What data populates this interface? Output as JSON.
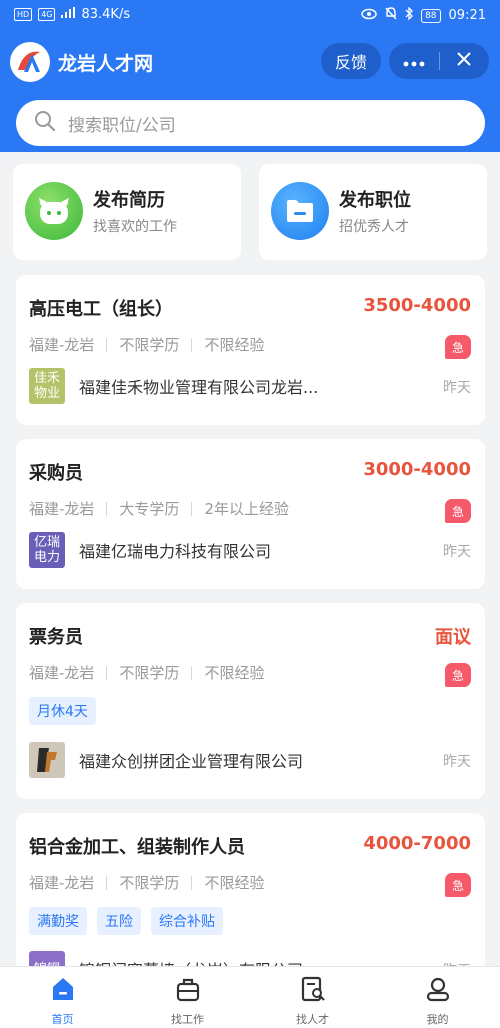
{
  "status_bar": {
    "left_badges": [
      "HD",
      "4G"
    ],
    "speed": "83.4K/s",
    "battery": "88",
    "time": "09:21"
  },
  "app": {
    "title": "龙岩人才网",
    "feedback": "反馈"
  },
  "search": {
    "placeholder": "搜索职位/公司"
  },
  "actions": [
    {
      "title": "发布简历",
      "subtitle": "找喜欢的工作",
      "icon": "face-icon",
      "color": "#5cc84a"
    },
    {
      "title": "发布职位",
      "subtitle": "招优秀人才",
      "icon": "folder-icon",
      "color": "#2f8ff5"
    }
  ],
  "jobs": [
    {
      "title": "高压电工（组长）",
      "salary": "3500-4000",
      "location": "福建-龙岩",
      "education": "不限学历",
      "experience": "不限经验",
      "urgent": "急",
      "tags": [],
      "company_logo": "佳禾物业",
      "company": "福建佳禾物业管理有限公司龙岩...",
      "time": "昨天"
    },
    {
      "title": "采购员",
      "salary": "3000-4000",
      "location": "福建-龙岩",
      "education": "大专学历",
      "experience": "2年以上经验",
      "urgent": "急",
      "tags": [],
      "company_logo": "亿瑞电力",
      "company": "福建亿瑞电力科技有限公司",
      "time": "昨天"
    },
    {
      "title": "票务员",
      "salary": "面议",
      "location": "福建-龙岩",
      "education": "不限学历",
      "experience": "不限经验",
      "urgent": "急",
      "tags": [
        "月休4天"
      ],
      "company_logo": "",
      "company": "福建众创拼团企业管理有限公司",
      "time": "昨天"
    },
    {
      "title": "铝合金加工、组装制作人员",
      "salary": "4000-7000",
      "location": "福建-龙岩",
      "education": "不限学历",
      "experience": "不限经验",
      "urgent": "急",
      "tags": [
        "满勤奖",
        "五险",
        "综合补贴"
      ],
      "company_logo": "锦铜",
      "company": "锦铜门窗幕墙（龙岩）有限公司",
      "time": "昨天"
    }
  ],
  "tabs": [
    {
      "label": "首页",
      "icon": "home-icon",
      "active": true
    },
    {
      "label": "找工作",
      "icon": "briefcase-icon",
      "active": false
    },
    {
      "label": "找人才",
      "icon": "resume-search-icon",
      "active": false
    },
    {
      "label": "我的",
      "icon": "user-icon",
      "active": false
    }
  ],
  "colors": {
    "primary": "#2b78f5",
    "salary": "#e8543d",
    "urgent": "#f45a6a",
    "background": "#f2f3f5"
  }
}
